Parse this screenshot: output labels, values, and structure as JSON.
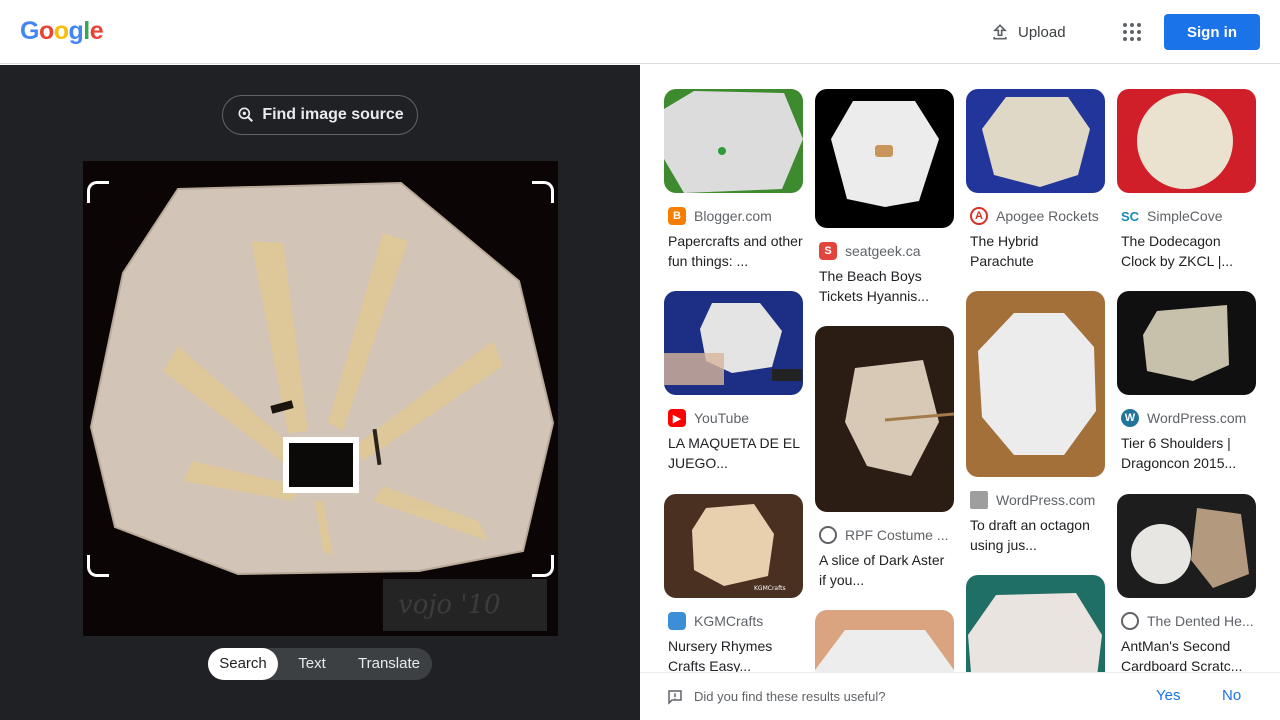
{
  "header": {
    "logo_letters": [
      {
        "ch": "G",
        "color": "#4285F4"
      },
      {
        "ch": "o",
        "color": "#EA4335"
      },
      {
        "ch": "o",
        "color": "#FBBC05"
      },
      {
        "ch": "g",
        "color": "#4285F4"
      },
      {
        "ch": "l",
        "color": "#34A853"
      },
      {
        "ch": "e",
        "color": "#EA4335"
      }
    ],
    "upload_label": "Upload",
    "apps_icon": "apps-grid-icon",
    "signin_label": "Sign in",
    "accent": "#1a73e8"
  },
  "viewer": {
    "find_source_label": "Find image source",
    "watermark": "vojo '10",
    "modes": [
      "Search",
      "Text",
      "Translate"
    ],
    "active_mode": "Search"
  },
  "results": [
    {
      "source": "Blogger.com",
      "icon": "blogger-icon",
      "title": "Papercrafts and other fun things: ..."
    },
    {
      "source": "seatgeek.ca",
      "icon": "seatgeek-icon",
      "title": "The Beach Boys Tickets Hyannis..."
    },
    {
      "source": "Apogee Rockets",
      "icon": "apogee-rockets-icon",
      "title": "The Hybrid Parachute"
    },
    {
      "source": "SimpleCove",
      "icon": "simplecove-icon",
      "title": "The Dodecagon Clock by ZKCL |..."
    },
    {
      "source": "YouTube",
      "icon": "youtube-icon",
      "title": "LA MAQUETA DE EL JUEGO..."
    },
    {
      "source": "RPF Costume ...",
      "icon": "globe-icon",
      "title": "A slice of Dark Aster if you..."
    },
    {
      "source": "WordPress.com",
      "icon": "pinwheel-icon",
      "title": "To draft an octagon using jus..."
    },
    {
      "source": "WordPress.com",
      "icon": "wordpress-icon",
      "title": "Tier 6 Shoulders | Dragoncon 2015..."
    },
    {
      "source": "KGMCrafts",
      "icon": "kgmcrafts-icon",
      "title": "Nursery Rhymes Crafts Easy..."
    },
    {
      "source": "The Dented He...",
      "icon": "globe-icon",
      "title": "AntMan's Second Cardboard Scratc..."
    }
  ],
  "feedback": {
    "question": "Did you find these results useful?",
    "yes": "Yes",
    "no": "No"
  }
}
